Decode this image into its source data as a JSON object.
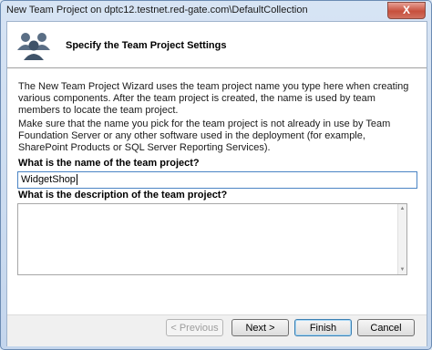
{
  "window": {
    "title": "New Team Project on dptc12.testnet.red-gate.com\\DefaultCollection",
    "close_label": "X"
  },
  "header": {
    "title": "Specify the Team Project Settings",
    "icon": "team-people-icon"
  },
  "body": {
    "para1": "The New Team Project Wizard uses the team project name you type here when creating various components. After the team project is created, the name is used by team members to locate the team project.",
    "para2": "Make sure that the name you pick for the team project is not already in use by Team Foundation Server or any other software used in the deployment (for example, SharePoint Products or SQL Server Reporting Services).",
    "name_label": "What is the name of the team project?",
    "name_value": "WidgetShop",
    "description_label": "What is the description of the team project?",
    "description_value": ""
  },
  "footer": {
    "previous_label": "< Previous",
    "next_label": "Next >",
    "finish_label": "Finish",
    "cancel_label": "Cancel"
  },
  "colors": {
    "accent": "#4b84c4",
    "header_bg": "#ffffff",
    "close_button": "#c7503d"
  }
}
